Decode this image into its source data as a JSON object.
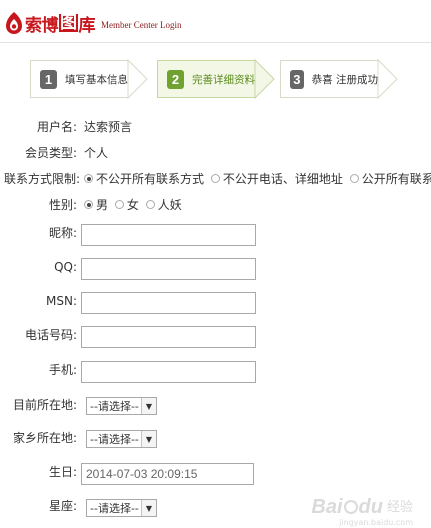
{
  "header": {
    "logo": {
      "part1": "索",
      "part2": "博",
      "part3": "图",
      "part4": "库",
      "subtitle": "Member Center Login"
    }
  },
  "steps": [
    {
      "num": "1",
      "label": "填写基本信息",
      "active": false
    },
    {
      "num": "2",
      "label": "完善详细资料",
      "active": true
    },
    {
      "num": "3",
      "label": "恭喜  注册成功",
      "active": false
    }
  ],
  "form": {
    "username": {
      "label": "用户名:",
      "value": "达索预言"
    },
    "member_type": {
      "label": "会员类型:",
      "value": "个人"
    },
    "contact_privacy": {
      "label": "联系方式限制:",
      "options": [
        "不公开所有联系方式",
        "不公开电话、详细地址",
        "公开所有联系方"
      ],
      "selected": 0
    },
    "gender": {
      "label": "性别:",
      "options": [
        "男",
        "女",
        "人妖"
      ],
      "selected": 0
    },
    "nickname": {
      "label": "昵称:",
      "value": ""
    },
    "qq": {
      "label": "QQ:",
      "value": ""
    },
    "msn": {
      "label": "MSN:",
      "value": ""
    },
    "phone": {
      "label": "电话号码:",
      "value": ""
    },
    "mobile": {
      "label": "手机:",
      "value": ""
    },
    "current_location": {
      "label": "目前所在地:",
      "selected": "--请选择--"
    },
    "hometown": {
      "label": "家乡所在地:",
      "selected": "--请选择--"
    },
    "birthday": {
      "label": "生日:",
      "value": "2014-07-03 20:09:15"
    },
    "zodiac": {
      "label": "星座:",
      "selected": "--请选择--"
    }
  },
  "watermark": {
    "brand": "Bai",
    "brand2": "du",
    "cn": "经验",
    "url": "jingyan.baidu.com"
  },
  "colors": {
    "brand_red": "#c8161d",
    "step_active": "#70a232",
    "step_inactive": "#666666"
  }
}
